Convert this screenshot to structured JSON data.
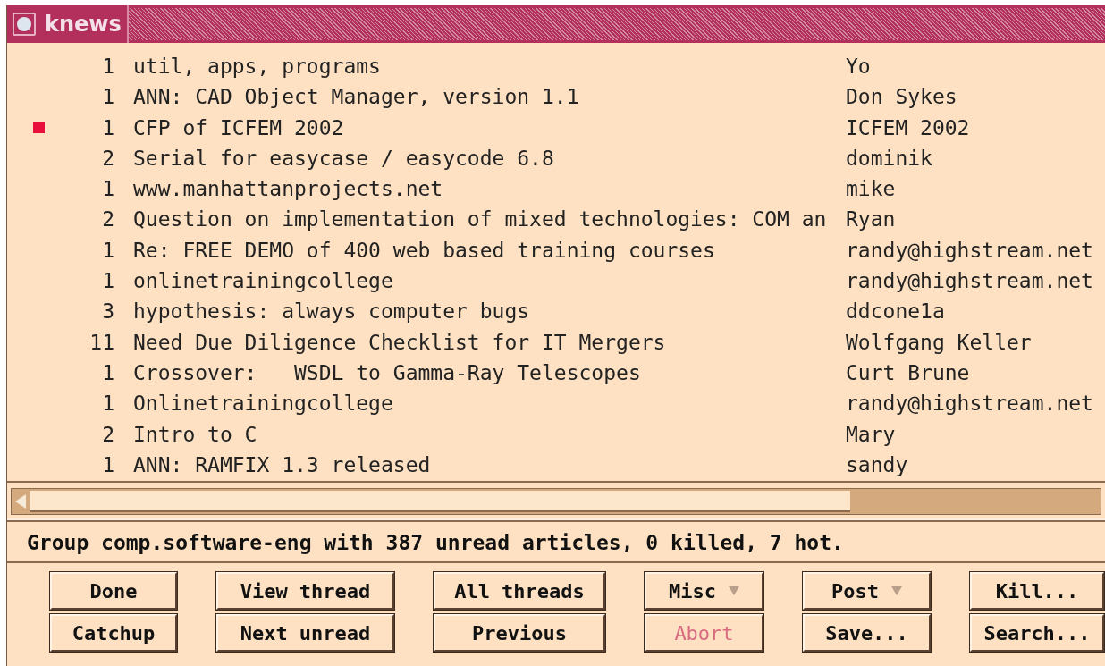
{
  "window": {
    "title": "knews"
  },
  "articles": [
    {
      "count": "1",
      "subject": "util, apps, programs",
      "author": "Yo",
      "marked": false
    },
    {
      "count": "1",
      "subject": "ANN: CAD Object Manager, version 1.1",
      "author": "Don Sykes",
      "marked": false
    },
    {
      "count": "1",
      "subject": "CFP of ICFEM 2002",
      "author": "ICFEM 2002",
      "marked": true
    },
    {
      "count": "2",
      "subject": "Serial for easycase / easycode 6.8",
      "author": "dominik",
      "marked": false
    },
    {
      "count": "1",
      "subject": "www.manhattanprojects.net",
      "author": "mike",
      "marked": false
    },
    {
      "count": "2",
      "subject": "Question on implementation of mixed technologies: COM an",
      "author": "Ryan",
      "marked": false
    },
    {
      "count": "1",
      "subject": "Re: FREE DEMO of 400 web based training courses",
      "author": "randy@highstream.net",
      "marked": false
    },
    {
      "count": "1",
      "subject": "onlinetrainingcollege",
      "author": "randy@highstream.net",
      "marked": false
    },
    {
      "count": "3",
      "subject": "hypothesis: always computer bugs",
      "author": "ddcone1a",
      "marked": false
    },
    {
      "count": "11",
      "subject": "Need Due Diligence Checklist for IT Mergers",
      "author": "Wolfgang Keller",
      "marked": false
    },
    {
      "count": "1",
      "subject": "Crossover:   WSDL to Gamma-Ray Telescopes",
      "author": "Curt Brune",
      "marked": false
    },
    {
      "count": "1",
      "subject": "Onlinetrainingcollege",
      "author": "randy@highstream.net",
      "marked": false
    },
    {
      "count": "2",
      "subject": "Intro to C",
      "author": "Mary",
      "marked": false
    },
    {
      "count": "1",
      "subject": "ANN: RAMFIX 1.3 released",
      "author": "sandy",
      "marked": false
    }
  ],
  "status": "Group comp.software-eng with 387 unread articles, 0 killed, 7 hot.",
  "buttons": [
    {
      "label": "Done",
      "disabled": false,
      "menu": false
    },
    {
      "label": "View thread",
      "disabled": false,
      "menu": false
    },
    {
      "label": "All threads",
      "disabled": false,
      "menu": false
    },
    {
      "label": "Misc",
      "disabled": false,
      "menu": true
    },
    {
      "label": "Post",
      "disabled": false,
      "menu": true
    },
    {
      "label": "Kill...",
      "disabled": false,
      "menu": false
    },
    {
      "label": "Catchup",
      "disabled": false,
      "menu": false
    },
    {
      "label": "Next unread",
      "disabled": false,
      "menu": false
    },
    {
      "label": "Previous",
      "disabled": false,
      "menu": false
    },
    {
      "label": "Abort",
      "disabled": true,
      "menu": false
    },
    {
      "label": "Save...",
      "disabled": false,
      "menu": false
    },
    {
      "label": "Search...",
      "disabled": false,
      "menu": false
    }
  ]
}
